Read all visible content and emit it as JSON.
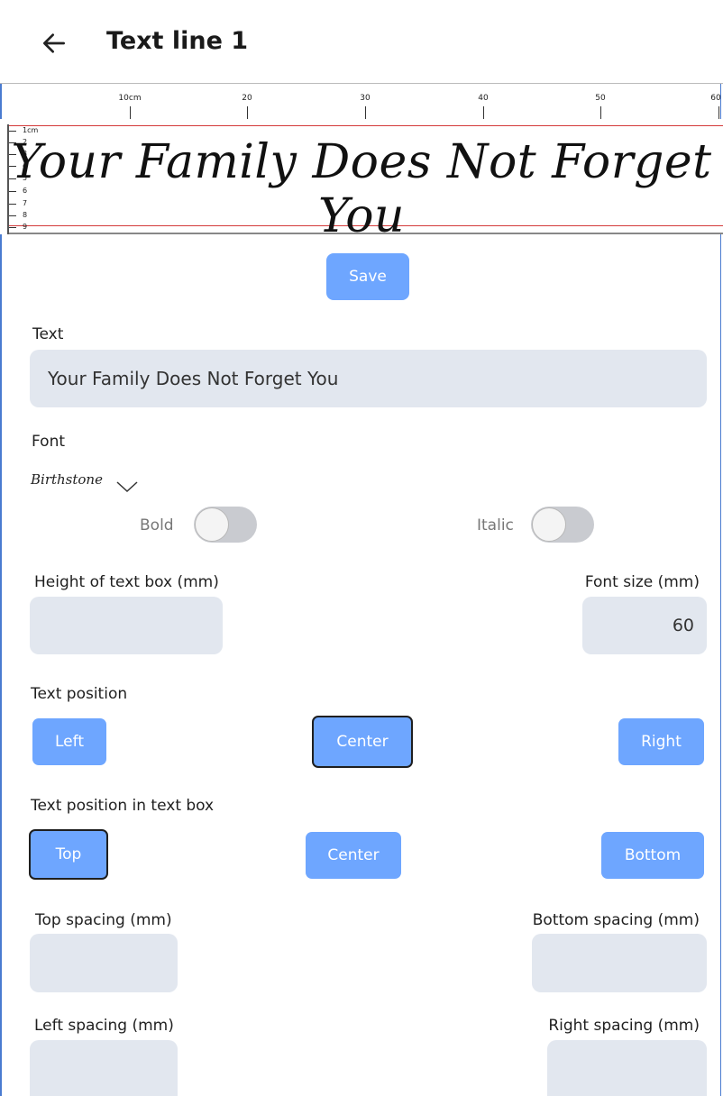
{
  "header": {
    "title": "Text line 1",
    "back_icon": "arrow-left-icon"
  },
  "ruler": {
    "top_labels": [
      "10cm",
      "20",
      "30",
      "40",
      "50",
      "60"
    ],
    "side_labels": [
      "1cm",
      "2",
      "3",
      "4",
      "5",
      "6",
      "7",
      "8",
      "9"
    ]
  },
  "preview": {
    "text": "Your Family Does Not Forget You"
  },
  "actions": {
    "save_label": "Save"
  },
  "text_field": {
    "label": "Text",
    "value": "Your Family Does Not Forget You"
  },
  "font": {
    "label": "Font",
    "selected": "Birthstone",
    "chevron_icon": "chevron-down-icon"
  },
  "toggles": {
    "bold": {
      "label": "Bold",
      "on": false
    },
    "italic": {
      "label": "Italic",
      "on": false
    }
  },
  "dimensions": {
    "height_label": "Height of text box (mm)",
    "height_value": "",
    "font_size_label": "Font size (mm)",
    "font_size_value": "60"
  },
  "text_position": {
    "label": "Text position",
    "options": [
      "Left",
      "Center",
      "Right"
    ],
    "selected": "Center"
  },
  "text_position_in_box": {
    "label": "Text position in text box",
    "options": [
      "Top",
      "Center",
      "Bottom"
    ],
    "selected": "Top"
  },
  "spacing": {
    "top_label": "Top spacing (mm)",
    "top_value": "",
    "bottom_label": "Bottom spacing (mm)",
    "bottom_value": "",
    "left_label": "Left spacing (mm)",
    "left_value": "",
    "right_label": "Right spacing (mm)",
    "right_value": ""
  },
  "colors": {
    "accent": "#6ea6ff",
    "field_bg": "#e2e7ef",
    "guide_red": "#d43a3a"
  }
}
